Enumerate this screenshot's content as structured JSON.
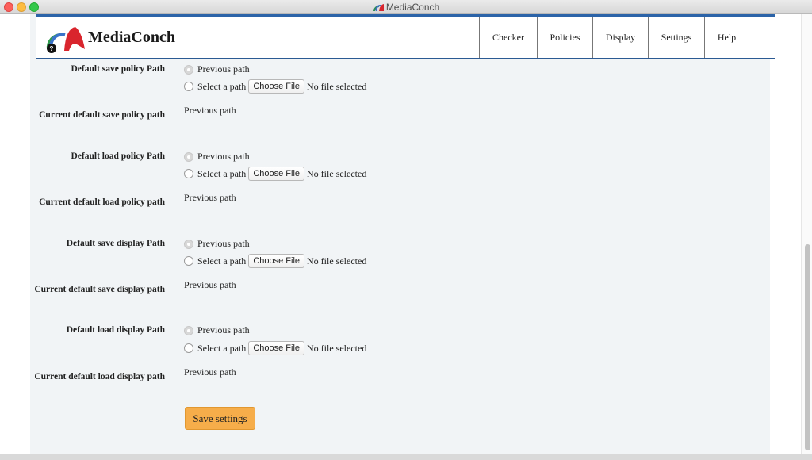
{
  "window": {
    "title": "MediaConch"
  },
  "header": {
    "brand": "MediaConch",
    "nav": [
      "Checker",
      "Policies",
      "Display",
      "Settings",
      "Help"
    ]
  },
  "settings": {
    "previous_label": "Previous path",
    "select_label": "Select a path",
    "choose_file_label": "Choose File",
    "no_file_label": "No file selected",
    "save_policy": {
      "label": "Default save policy Path",
      "current_label": "Current default save policy path",
      "current_value": "Previous path"
    },
    "load_policy": {
      "label": "Default load policy Path",
      "current_label": "Current default load policy path",
      "current_value": "Previous path"
    },
    "save_display": {
      "label": "Default save display Path",
      "current_label": "Current default save display path",
      "current_value": "Previous path"
    },
    "load_display": {
      "label": "Default load display Path",
      "current_label": "Current default load display path",
      "current_value": "Previous path"
    },
    "save_button": "Save settings"
  },
  "colors": {
    "accent": "#2b63a8",
    "button": "#f6ad4a",
    "page_bg": "#f1f4f6"
  }
}
